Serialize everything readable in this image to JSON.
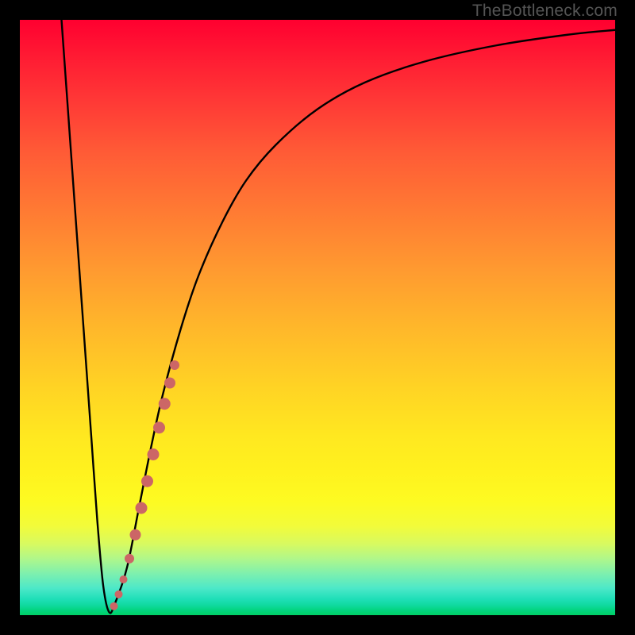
{
  "watermark": "TheBottleneck.com",
  "chart_data": {
    "type": "line",
    "title": "",
    "xlabel": "",
    "ylabel": "",
    "xlim": [
      0,
      100
    ],
    "ylim": [
      0,
      100
    ],
    "grid": false,
    "legend": false,
    "series": [
      {
        "name": "bottleneck-curve",
        "color": "#000000",
        "x": [
          7,
          8,
          9,
          10,
          11,
          12,
          13,
          14,
          15,
          16,
          18,
          20,
          22,
          24,
          27,
          30,
          34,
          38,
          43,
          50,
          58,
          68,
          80,
          92,
          100
        ],
        "y": [
          100,
          86,
          72,
          58,
          44,
          30,
          16,
          5,
          0.5,
          2,
          8,
          18,
          28,
          37,
          48,
          57,
          66,
          73,
          79,
          85,
          89.5,
          93,
          95.7,
          97.5,
          98.3
        ]
      }
    ],
    "markers": {
      "name": "highlight-dots",
      "color": "#cc6666",
      "points": [
        {
          "x": 15.8,
          "y": 1.5,
          "r": 5
        },
        {
          "x": 16.6,
          "y": 3.5,
          "r": 5
        },
        {
          "x": 17.4,
          "y": 6.0,
          "r": 5
        },
        {
          "x": 18.4,
          "y": 9.5,
          "r": 6
        },
        {
          "x": 19.4,
          "y": 13.5,
          "r": 7
        },
        {
          "x": 20.4,
          "y": 18.0,
          "r": 7.5
        },
        {
          "x": 21.4,
          "y": 22.5,
          "r": 7.5
        },
        {
          "x": 22.4,
          "y": 27.0,
          "r": 7.5
        },
        {
          "x": 23.4,
          "y": 31.5,
          "r": 7.5
        },
        {
          "x": 24.3,
          "y": 35.5,
          "r": 7.5
        },
        {
          "x": 25.2,
          "y": 39.0,
          "r": 7
        },
        {
          "x": 26.0,
          "y": 42.0,
          "r": 6
        }
      ]
    }
  }
}
